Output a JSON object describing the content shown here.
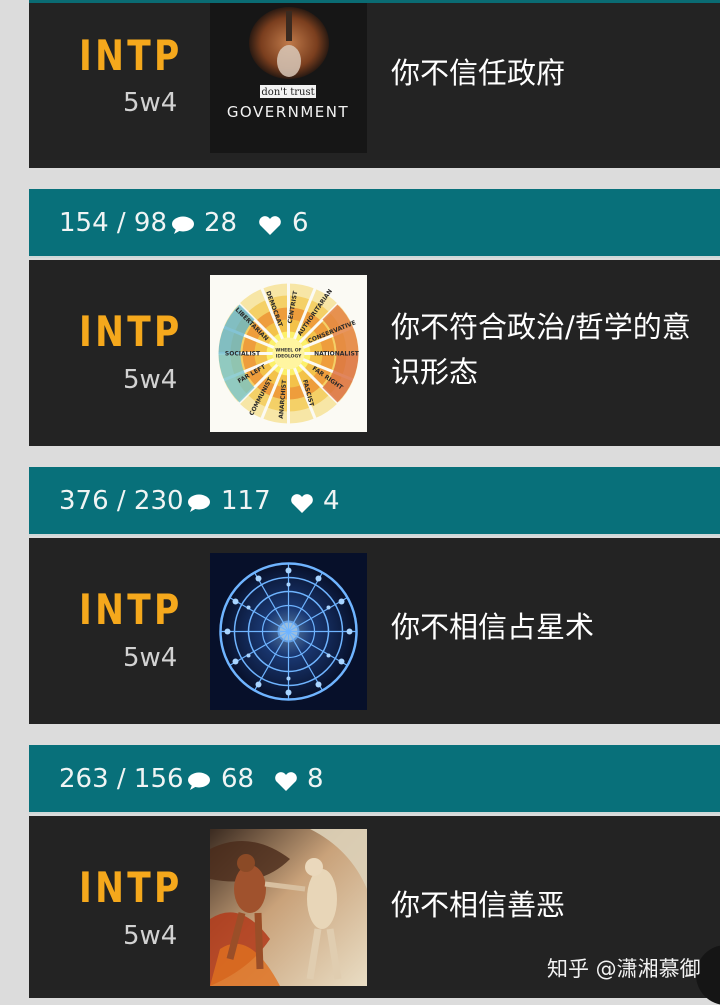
{
  "posts": [
    {
      "type": "INTP",
      "wing": "5w4",
      "caption": "你不信任政府",
      "image": "dont-trust-government-image",
      "image_text_small": "don't trust",
      "image_text_big": "GOVERNMENT"
    },
    {
      "ratio": "154 / 98",
      "comments": "28",
      "likes": "6",
      "type": "INTP",
      "wing": "5w4",
      "caption": "你不符合政治/哲学的意识形态",
      "image": "wheel-of-ideology-image",
      "wheel_labels": [
        "WHEEL OF",
        "IDEOLOGY",
        "SOCIALIST",
        "NATIONALIST",
        "CONSERVATIVE",
        "LIBERTARIAN",
        "CENTRIST",
        "AUTHORITARIAN",
        "FAR LEFT",
        "COMMUNIST",
        "ANARCHIST",
        "FASCIST",
        "FAR RIGHT",
        "DEMOCRAT"
      ]
    },
    {
      "ratio": "376 / 230",
      "comments": "117",
      "likes": "4",
      "type": "INTP",
      "wing": "5w4",
      "caption": "你不相信占星术",
      "image": "zodiac-wheel-image"
    },
    {
      "ratio": "263 / 156",
      "comments": "68",
      "likes": "8",
      "type": "INTP",
      "wing": "5w4",
      "caption": "你不相信善恶",
      "image": "good-and-evil-painting-image"
    }
  ],
  "watermark": "知乎 @潇湘慕御",
  "colors": {
    "teal": "#08707a",
    "card": "#232323",
    "accent": "#f5a81c",
    "text": "#ffffff"
  },
  "icons": {
    "comment": "comment-bubble-icon",
    "like": "heart-icon"
  }
}
